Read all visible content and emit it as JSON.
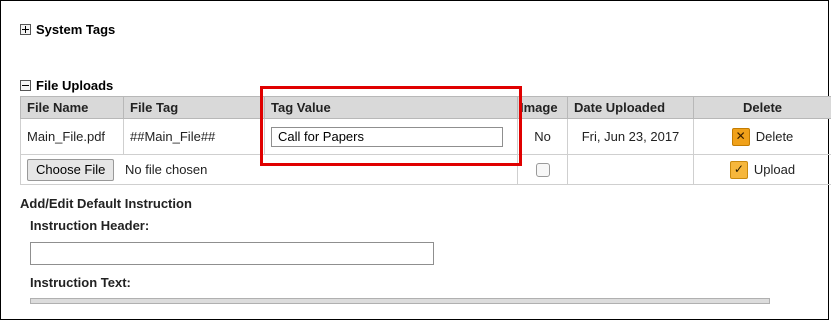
{
  "system_tags": {
    "label": "System Tags"
  },
  "file_uploads": {
    "label": "File Uploads",
    "columns": [
      "File Name",
      "File Tag",
      "Tag Value",
      "Image",
      "Date Uploaded",
      "Delete"
    ],
    "row": {
      "file_name": "Main_File.pdf",
      "file_tag": "##Main_File##",
      "tag_value": "Call for Papers",
      "image": "No",
      "date_uploaded": "Fri, Jun 23, 2017",
      "delete_label": "Delete"
    },
    "upload_row": {
      "choose_file_label": "Choose File",
      "no_file_text": "No file chosen",
      "upload_label": "Upload"
    }
  },
  "instruction": {
    "section_title": "Add/Edit Default Instruction",
    "header_label": "Instruction Header:",
    "header_value": "",
    "text_label": "Instruction Text:"
  },
  "colors": {
    "highlight": "#e00000",
    "header_bg": "#d9d9d9",
    "icon_orange": "#f0a11a"
  },
  "icons": [
    "plus-toggle-icon",
    "minus-toggle-icon",
    "delete-x-icon",
    "upload-check-icon"
  ]
}
